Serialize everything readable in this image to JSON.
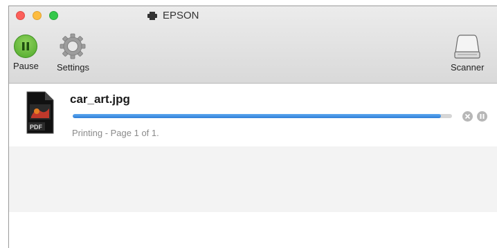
{
  "window": {
    "title": "EPSON"
  },
  "toolbar": {
    "pause_label": "Pause",
    "settings_label": "Settings",
    "scanner_label": "Scanner"
  },
  "job": {
    "name": "car_art.jpg",
    "status": "Printing - Page 1 of 1.",
    "progress": 0.97,
    "icon_badge": "PDF"
  },
  "colors": {
    "progress_blue": "#2f7fd8",
    "pause_green": "#5cb82e",
    "traffic_close": "#fc605b",
    "traffic_minimize": "#fdbc40",
    "traffic_maximize": "#34c84a"
  },
  "icons": {
    "title": "printer-icon",
    "pause": "pause-icon",
    "settings": "gear-icon",
    "scanner": "scanner-icon",
    "document": "pdf-document-icon",
    "cancel": "cancel-icon",
    "hold": "pause-small-icon"
  }
}
